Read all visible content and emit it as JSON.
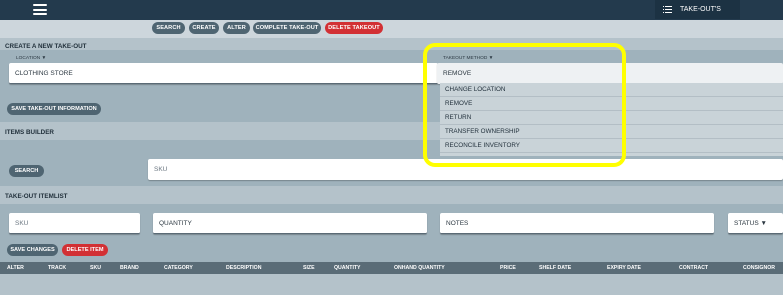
{
  "topbar": {
    "takeouts_label": "TAKE-OUT'S"
  },
  "actions": {
    "search": "SEARCH",
    "create": "CREATE",
    "alter": "ALTER",
    "complete": "COMPLETE TAKE-OUT",
    "delete": "DELETE TAKEOUT"
  },
  "create_section": {
    "title": "CREATE A NEW TAKE-OUT",
    "location_label": "LOCATION ▼",
    "location_value": "CLOTHING STORE",
    "method_label": "TAKEOUT METHOD ▼",
    "method_value": "REMOVE",
    "save_button": "SAVE TAKE-OUT INFORMATION"
  },
  "method_dropdown": {
    "options": [
      "CHANGE LOCATION",
      "REMOVE",
      "RETURN",
      "TRANSFER OWNERSHIP",
      "RECONCILE INVENTORY"
    ]
  },
  "items_builder": {
    "title": "ITEMS BUILDER",
    "search_button": "SEARCH",
    "sku_placeholder": "SKU"
  },
  "itemlist": {
    "title": "TAKE-OUT ITEMLIST",
    "sku_placeholder": "SKU",
    "quantity_placeholder": "QUANTITY",
    "notes_placeholder": "NOTES",
    "status_label": "STATUS ▼",
    "save_changes": "SAVE CHANGES",
    "delete_item": "DELETE ITEM"
  },
  "table": {
    "columns": [
      "ALTER",
      "TRACK",
      "SKU",
      "BRAND",
      "CATEGORY",
      "DESCRIPTION",
      "SIZE",
      "QUANTITY",
      "ONHAND QUANTITY",
      "PRICE",
      "SHELF DATE",
      "EXPIRY DATE",
      "CONTRACT",
      "CONSIGNOR"
    ]
  },
  "colors": {
    "topbar": "#233a4d",
    "accent_red": "#d23034",
    "pill_dark": "#4f6572",
    "highlight": "#ffff00"
  }
}
